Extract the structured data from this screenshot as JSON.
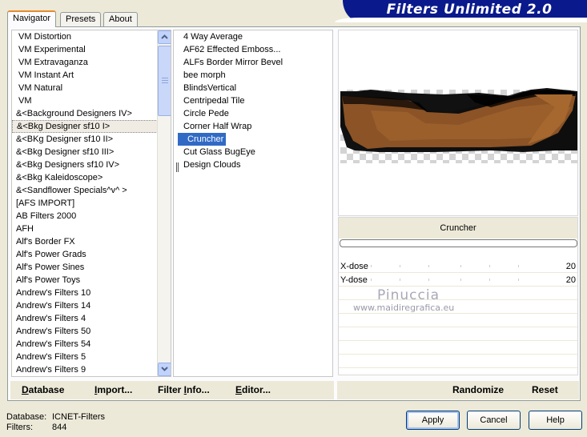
{
  "tabs": [
    {
      "label": "Navigator",
      "active": true
    },
    {
      "label": "Presets",
      "active": false
    },
    {
      "label": "About",
      "active": false
    }
  ],
  "banner": {
    "title": "Filters Unlimited 2.0",
    "color": "#0a1a8c"
  },
  "categories": [
    "VM Distortion",
    "VM Experimental",
    "VM Extravaganza",
    "VM Instant Art",
    "VM Natural",
    "VM",
    "&<Background Designers IV>",
    "&<Bkg Designer sf10 I>",
    "&<BKg Designer sf10 II>",
    "&<Bkg Designer sf10 III>",
    "&<Bkg Designers sf10 IV>",
    "&<Bkg Kaleidoscope>",
    "&<Sandflower Specials^v^ >",
    "[AFS IMPORT]",
    "AB Filters 2000",
    "AFH",
    "Alf's Border FX",
    "Alf's Power Grads",
    "Alf's Power Sines",
    "Alf's Power Toys",
    "Andrew's Filters 10",
    "Andrew's Filters 14",
    "Andrew's Filters 4",
    "Andrew's Filters 50",
    "Andrew's Filters 54",
    "Andrew's Filters 5",
    "Andrew's Filters 9"
  ],
  "selected_category": "&<Bkg Designer sf10 I>",
  "filters": [
    "4 Way Average",
    "AF62 Effected Emboss...",
    "ALFs Border Mirror Bevel",
    "bee morph",
    "BlindsVertical",
    "Centripedal Tile",
    "Circle Pede",
    "Corner Half Wrap",
    "Cruncher",
    "Cut Glass  BugEye",
    "Design Clouds"
  ],
  "selected_filter": "Cruncher",
  "current_filter_name": "Cruncher",
  "params": [
    {
      "label": "X-dose",
      "value": "20"
    },
    {
      "label": "Y-dose",
      "value": "20"
    }
  ],
  "watermark": {
    "name": "Pinuccia",
    "url": "www.maidiregrafica.eu"
  },
  "bottom_left": {
    "database": {
      "hot": "D",
      "rest": "atabase"
    },
    "import": {
      "hot": "I",
      "rest": "mport..."
    },
    "filter_info": {
      "pre": "Filter ",
      "hot": "I",
      "rest": "nfo..."
    },
    "editor": {
      "hot": "E",
      "rest": "ditor..."
    }
  },
  "bottom_right": {
    "randomize": "Randomize",
    "reset": "Reset"
  },
  "footer": {
    "database_label": "Database:",
    "database_value": "ICNET-Filters",
    "filters_label": "Filters:",
    "filters_value": "844"
  },
  "buttons": {
    "apply": "Apply",
    "cancel": "Cancel",
    "help": "Help"
  },
  "colors": {
    "selection": "#316ac5",
    "preview_brown": "#8b5326",
    "tab_accent": "#e68b2c"
  }
}
